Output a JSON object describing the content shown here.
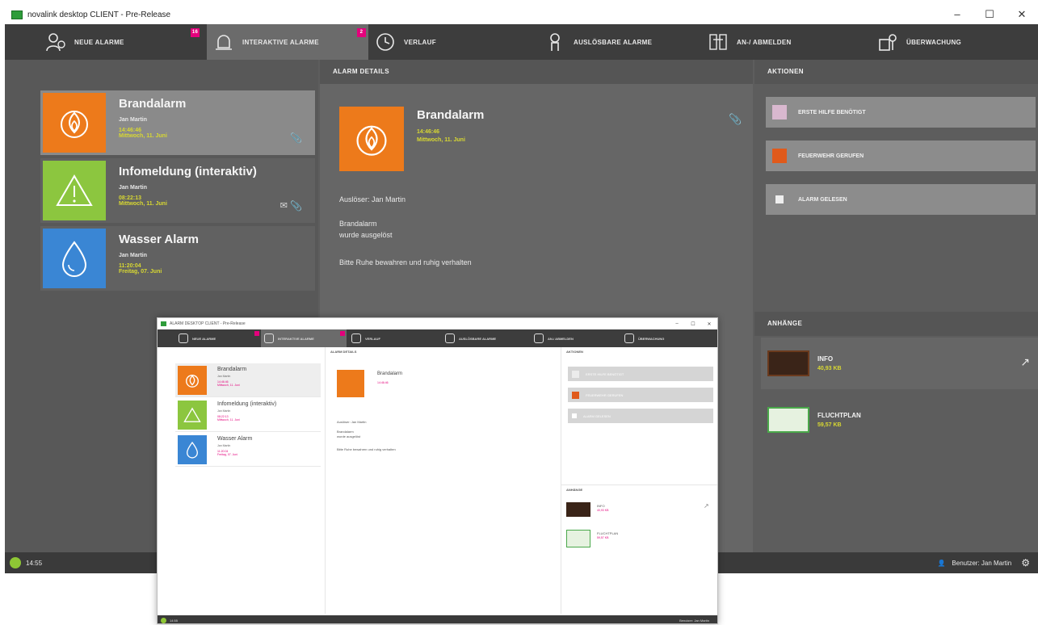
{
  "window": {
    "title": "novalink desktop CLIENT - Pre-Release",
    "controls": [
      "–",
      "☐",
      "✕"
    ]
  },
  "nav": {
    "tabs": [
      {
        "label": "NEUE ALARME",
        "badge": "16",
        "icon": "person-alert-icon"
      },
      {
        "label": "INTERAKTIVE ALARME",
        "badge": "2",
        "icon": "alarm-bell-icon"
      },
      {
        "label": "VERLAUF",
        "icon": "history-clock-icon"
      },
      {
        "label": "AUSLÖSBARE ALARME",
        "icon": "trigger-hand-icon"
      },
      {
        "label": "AN-/ ABMELDEN",
        "icon": "login-users-icon"
      },
      {
        "label": "ÜBERWACHUNG",
        "icon": "monitoring-icon"
      }
    ]
  },
  "alarms": [
    {
      "title": "Brandalarm",
      "by": "Jan Martin",
      "time": "14:46:46",
      "date": "Mittwoch, 11. Juni",
      "color": "#ed7a1b",
      "icon": "fire-icon"
    },
    {
      "title": "Infomeldung (interaktiv)",
      "by": "Jan Martin",
      "time": "08:22:13",
      "date": "Mittwoch, 11. Juni",
      "color": "#8cc63f",
      "icon": "warning-triangle-icon"
    },
    {
      "title": "Wasser Alarm",
      "by": "Jan Martin",
      "time": "11:20:04",
      "date": "Freitag, 07. Juni",
      "color": "#3a86d4",
      "icon": "water-drop-icon"
    }
  ],
  "details": {
    "header": "ALARM DETAILS",
    "title": "Brandalarm",
    "time": "14:46:46",
    "date": "Mittwoch, 11. Juni",
    "trigger": "Auslöser: Jan Martin",
    "line1": "Brandalarm",
    "line2": "wurde ausgelöst",
    "line3": "Bitte Ruhe bewahren und ruhig verhalten"
  },
  "actions": {
    "header": "AKTIONEN",
    "items": [
      {
        "label": "ERSTE HILFE BENÖTIGT",
        "color": "#d9b8cf"
      },
      {
        "label": "FEUERWEHR GERUFEN",
        "color": "#e05a1b"
      },
      {
        "label": "ALARM GELESEN",
        "color": "#eeeeee"
      }
    ]
  },
  "attachments": {
    "header": "ANHÄNGE",
    "items": [
      {
        "name": "INFO",
        "size": "40,93 KB"
      },
      {
        "name": "FLUCHTPLAN",
        "size": "59,57 KB"
      }
    ]
  },
  "status": {
    "time": "14:55",
    "user": "Benutzer: Jan Martin"
  },
  "mini": {
    "title": "ALARM DESKTOP CLIENT - Pre-Release"
  }
}
